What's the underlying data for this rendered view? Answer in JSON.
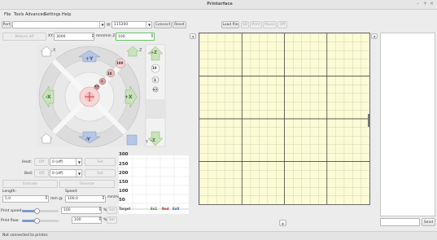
{
  "window": {
    "title": "Printerface",
    "controls": [
      "–",
      "+",
      "×"
    ]
  },
  "menu": [
    "File",
    "Tools",
    "Advanced",
    "Settings",
    "Help"
  ],
  "connection": {
    "port_label": "Port",
    "port_value": "",
    "baud_symbol": "@",
    "baud_value": "115200",
    "connect": "Connect",
    "reset": "Reset"
  },
  "file_toolbar": {
    "load": "Load file",
    "sd": "SD",
    "print": "Print",
    "pause": "Pause",
    "off": "Off"
  },
  "motors": {
    "label": "Motors off",
    "xy_label": "XY:",
    "xy_value": "3000",
    "z_label": "mm/min Z:",
    "z_value": "100"
  },
  "jog": {
    "home_x": "X",
    "home_y": "Y",
    "home_z": "Z",
    "plus_y": "+Y",
    "minus_y": "-Y",
    "plus_x": "+X",
    "minus_x": "-X",
    "plus_z": "+Z",
    "minus_z": "-Z",
    "steps": [
      "100",
      "10",
      "1",
      "0.1"
    ],
    "z_steps": [
      "10",
      "1",
      "0.1"
    ]
  },
  "heat": {
    "label": "Heat:",
    "off": "Off",
    "value": "0 (off)",
    "set": "Set"
  },
  "bed": {
    "label": "Bed:",
    "off": "Off",
    "value": "0 (off)",
    "set": "Set"
  },
  "extrude": {
    "extrude": "Extrude",
    "reverse": "Reverse"
  },
  "length": {
    "label": "Length:",
    "value": "5.0",
    "unit": "mm @"
  },
  "speed": {
    "label": "Speed:",
    "value": "100.0",
    "unit": "mm/min"
  },
  "print_speed": {
    "label": "Print speed:",
    "value": "100",
    "unit": "%",
    "set": "Set",
    "level": 0.4
  },
  "print_flow": {
    "label": "Print flow:",
    "value": "100",
    "unit": "%",
    "set": "Set",
    "level": 0.4
  },
  "temp_graph": {
    "ticks": [
      "300",
      "250",
      "200",
      "150",
      "100",
      "50"
    ],
    "target": "Target",
    "ex1": "Ex1",
    "bed": "Bed",
    "ex0": "Ex0"
  },
  "console": {
    "send": "Send",
    "input": ""
  },
  "status": "Not connected to printer."
}
